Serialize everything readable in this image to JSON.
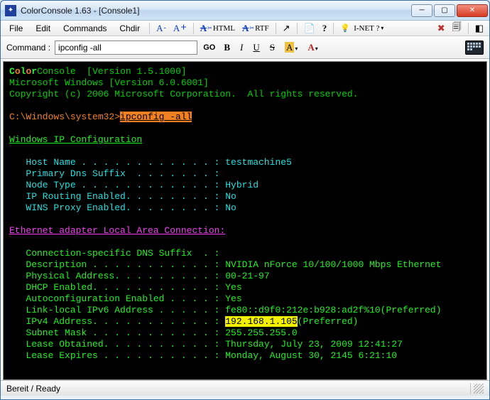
{
  "window": {
    "title": "ColorConsole 1.63  -  [Console1]"
  },
  "menu": {
    "file": "File",
    "edit": "Edit",
    "commands": "Commands",
    "chdir": "Chdir"
  },
  "toolbar": {
    "fontMinus": "A-",
    "fontPlus": "A+",
    "html": "HTML",
    "rtf": "RTF",
    "inet": "I-NET ?"
  },
  "cmd": {
    "label": "Command :",
    "value": "ipconfig -all",
    "go": "GO"
  },
  "console": {
    "banner_app": "ColorConsole",
    "banner_ver": "  [Version 1.5.1000]",
    "banner_os": "Microsoft Windows [Version 6.0.6001]",
    "banner_copy": "Copyright (c) 2006 Microsoft Corporation.  All rights reserved.",
    "prompt_path": "C:\\Windows\\system32>",
    "prompt_cmd": "ipconfig -all",
    "h_ipcfg": "Windows IP Configuration",
    "lines_ipcfg": [
      "   Host Name . . . . . . . . . . . . : testmachine5",
      "   Primary Dns Suffix  . . . . . . . :",
      "   Node Type . . . . . . . . . . . . : Hybrid",
      "   IP Routing Enabled. . . . . . . . : No",
      "   WINS Proxy Enabled. . . . . . . . : No"
    ],
    "h_eth": "Ethernet adapter Local Area Connection:",
    "eth_pre": [
      "   Connection-specific DNS Suffix  . :",
      "   Description . . . . . . . . . . . : NVIDIA nForce 10/100/1000 Mbps Ethernet",
      "   Physical Address. . . . . . . . . : 00-21-97",
      "   DHCP Enabled. . . . . . . . . . . : Yes",
      "   Autoconfiguration Enabled . . . . : Yes",
      "   Link-local IPv6 Address . . . . . : fe80::d9f0:212e:b928:ad2f%10(Preferred)"
    ],
    "eth_ipv4_label": "   IPv4 Address. . . . . . . . . . . : ",
    "eth_ipv4_value": "192.168.1.105",
    "eth_ipv4_suffix": "(Preferred)",
    "eth_post": [
      "   Subnet Mask . . . . . . . . . . . : 255.255.255.0",
      "   Lease Obtained. . . . . . . . . . : Thursday, July 23, 2009 12:41:27",
      "   Lease Expires . . . . . . . . . . : Monday, August 30, 2145 6:21:10"
    ]
  },
  "status": {
    "text": "Bereit / Ready"
  }
}
